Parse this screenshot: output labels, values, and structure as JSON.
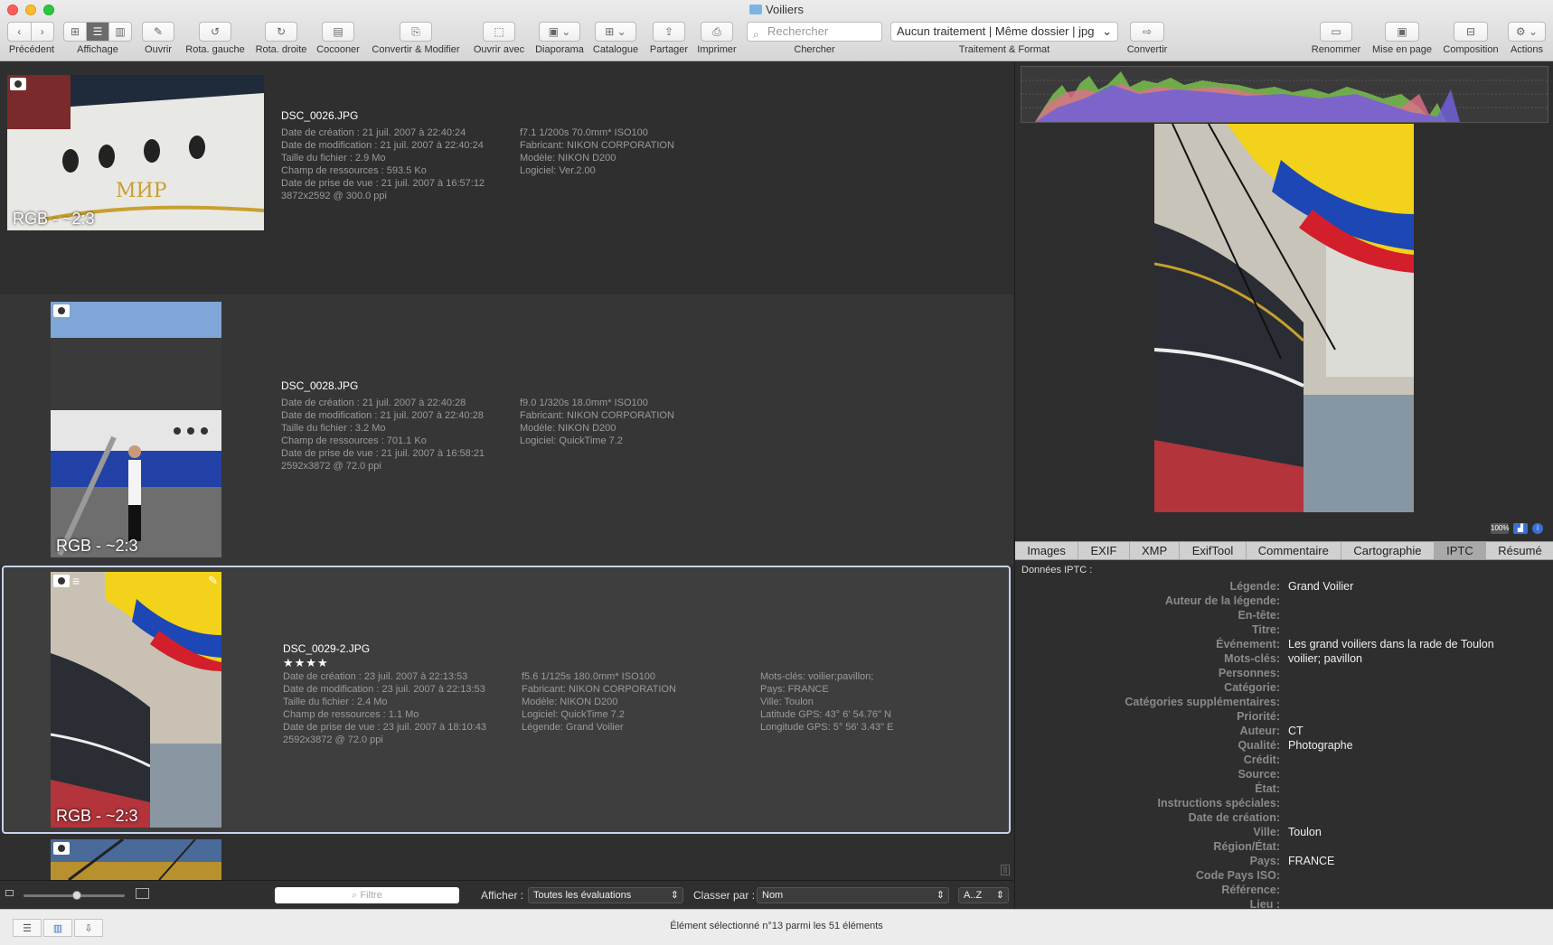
{
  "window": {
    "title": "Voiliers"
  },
  "toolbar": {
    "back_label": "Précédent",
    "view_label": "Affichage",
    "open_label": "Ouvrir",
    "rot_left_label": "Rota. gauche",
    "rot_right_label": "Rota. droite",
    "cocoon_label": "Cocooner",
    "convert_modify_label": "Convertir & Modifier",
    "open_with_label": "Ouvrir avec",
    "slideshow_label": "Diaporama",
    "catalog_label": "Catalogue",
    "share_label": "Partager",
    "print_label": "Imprimer",
    "search_placeholder": "Rechercher",
    "search_label": "Chercher",
    "processing_value": "Aucun traitement | Même dossier | jpg",
    "processing_label": "Traitement & Format",
    "convert_label": "Convertir",
    "rename_label": "Renommer",
    "layout_label": "Mise en page",
    "composition_label": "Composition",
    "actions_label": "Actions"
  },
  "files": [
    {
      "name": "DSC_0026.JPG",
      "overlay": "RGB - ~2:3",
      "info": [
        "Date de création : 21 juil. 2007 à 22:40:24",
        "Date de modification : 21 juil. 2007 à 22:40:24",
        "Taille du fichier : 2.9  Mo",
        "Champ de ressources : 593.5 Ko",
        "Date de prise de vue : 21 juil. 2007 à 16:57:12",
        "3872x2592 @ 300.0 ppi"
      ],
      "exif": [
        "f7.1 1/200s 70.0mm* ISO100",
        "Fabricant: NIKON CORPORATION",
        "Modèle: NIKON D200",
        "Logiciel: Ver.2.00"
      ]
    },
    {
      "name": "DSC_0028.JPG",
      "overlay": "RGB - ~2:3",
      "info": [
        "Date de création : 21 juil. 2007 à 22:40:28",
        "Date de modification : 21 juil. 2007 à 22:40:28",
        "Taille du fichier : 3.2  Mo",
        "Champ de ressources : 701.1 Ko",
        "Date de prise de vue : 21 juil. 2007 à 16:58:21",
        "2592x3872 @ 72.0 ppi"
      ],
      "exif": [
        "f9.0 1/320s 18.0mm* ISO100",
        "Fabricant: NIKON CORPORATION",
        "Modèle: NIKON D200",
        "Logiciel: QuickTime 7.2"
      ]
    },
    {
      "name": "DSC_0029-2.JPG",
      "rating": "★★★★",
      "overlay": "RGB - ~2:3",
      "info": [
        "Date de création : 23 juil. 2007 à 22:13:53",
        "Date de modification : 23 juil. 2007 à 22:13:53",
        "Taille du fichier : 2.4  Mo",
        "Champ de ressources : 1.1  Mo",
        "Date de prise de vue : 23 juil. 2007 à 18:10:43",
        "2592x3872 @ 72.0 ppi"
      ],
      "exif": [
        "f5.6 1/125s 180.0mm* ISO100",
        "Fabricant: NIKON CORPORATION",
        "Modèle: NIKON D200",
        "Logiciel: QuickTime 7.2",
        "Légende: Grand Voilier"
      ],
      "extra": [
        "Mots-clés: voilier;pavillon;",
        "Pays: FRANCE",
        "Ville: Toulon",
        "Latitude GPS: 43° 6' 54.76\" N",
        "Longitude GPS: 5° 56' 3.43\" E"
      ]
    }
  ],
  "listbar": {
    "filter_placeholder": "Filtre",
    "show_label": "Afficher :",
    "show_value": "Toutes les évaluations",
    "sort_label": "Classer par :",
    "sort_value": "Nom",
    "order_value": "A..Z"
  },
  "preview_badges": [
    "100%"
  ],
  "tabs": [
    "Images",
    "EXIF",
    "XMP",
    "ExifTool",
    "Commentaire",
    "Cartographie",
    "IPTC",
    "Résumé"
  ],
  "active_tab": "IPTC",
  "iptc": {
    "header": "Données IPTC :",
    "rows": [
      {
        "k": "Légende:",
        "v": "Grand Voilier"
      },
      {
        "k": "Auteur de la légende:",
        "v": ""
      },
      {
        "k": "En-tête:",
        "v": ""
      },
      {
        "k": "Titre:",
        "v": ""
      },
      {
        "k": "Événement:",
        "v": "Les grand voiliers dans la rade de Toulon"
      },
      {
        "k": "Mots-clés:",
        "v": "voilier; pavillon"
      },
      {
        "k": "Personnes:",
        "v": ""
      },
      {
        "k": "Catégorie:",
        "v": ""
      },
      {
        "k": "Catégories supplémentaires:",
        "v": ""
      },
      {
        "k": "Priorité:",
        "v": ""
      },
      {
        "k": "Auteur:",
        "v": "CT"
      },
      {
        "k": "Qualité:",
        "v": "Photographe"
      },
      {
        "k": "Crédit:",
        "v": ""
      },
      {
        "k": "Source:",
        "v": ""
      },
      {
        "k": "État:",
        "v": ""
      },
      {
        "k": "Instructions spéciales:",
        "v": ""
      },
      {
        "k": "Date de création:",
        "v": ""
      },
      {
        "k": "Ville:",
        "v": "Toulon"
      },
      {
        "k": "Région/État:",
        "v": ""
      },
      {
        "k": "Pays:",
        "v": "FRANCE"
      },
      {
        "k": "Code Pays ISO:",
        "v": ""
      },
      {
        "k": "Référence:",
        "v": ""
      },
      {
        "k": "Lieu :",
        "v": ""
      }
    ]
  },
  "status": {
    "text": "Élément sélectionné n°13 parmi les 51 éléments"
  }
}
